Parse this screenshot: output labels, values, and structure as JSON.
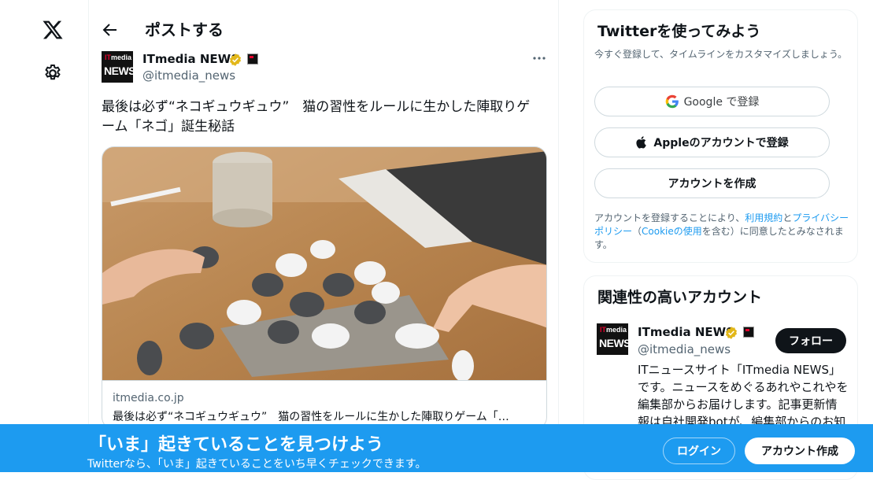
{
  "nav": {
    "logo_icon": "x-logo-icon",
    "settings_icon": "gear-icon"
  },
  "header": {
    "title": "ポストする"
  },
  "post": {
    "author_name": "ITmedia NEWS",
    "author_handle": "@itmedia_news",
    "avatar_text": {
      "top_left": "IT",
      "top_right": "media",
      "bottom": "NEWS"
    },
    "text": "最後は必ず“ネコギュウギュウ”　猫の習性をルールに生かした陣取りゲーム「ネゴ」誕生秘話",
    "card": {
      "domain": "itmedia.co.jp",
      "title": "最後は必ず“ネコギュウギュウ”　猫の習性をルールに生かした陣取りゲーム「…"
    }
  },
  "signup": {
    "title": "Twitterを使ってみよう",
    "subtitle": "今すぐ登録して、タイムラインをカスタマイズしましょう。",
    "google_label": "Google で登録",
    "apple_label": "Appleのアカウントで登録",
    "create_label": "アカウントを作成",
    "legal": {
      "pre": "アカウントを登録することにより、",
      "terms": "利用規約",
      "and": "と",
      "privacy": "プライバシーポリシー",
      "paren_open": "（",
      "cookie": "Cookieの使用",
      "post": "を含む）に同意したとみなされます。"
    }
  },
  "related": {
    "title": "関連性の高いアカウント",
    "name": "ITmedia NEWS",
    "handle": "@itmedia_news",
    "follow_label": "フォロー",
    "bio": "ITニュースサイト「ITmedia NEWS」です。ニュースをめぐるあれやこれやを編集部からお届けします。記事更新情報は自社開発botが、編集部からのお知らせ"
  },
  "banner": {
    "title": "「いま」起きていることを見つけよう",
    "subtitle": "Twitterなら、「いま」起きていることをいち早くチェックできます。",
    "login_label": "ログイン",
    "signup_label": "アカウント作成"
  },
  "colors": {
    "accent": "#1d9bf0",
    "verified": "#e2b719",
    "text": "#0f1419",
    "muted": "#536471"
  }
}
